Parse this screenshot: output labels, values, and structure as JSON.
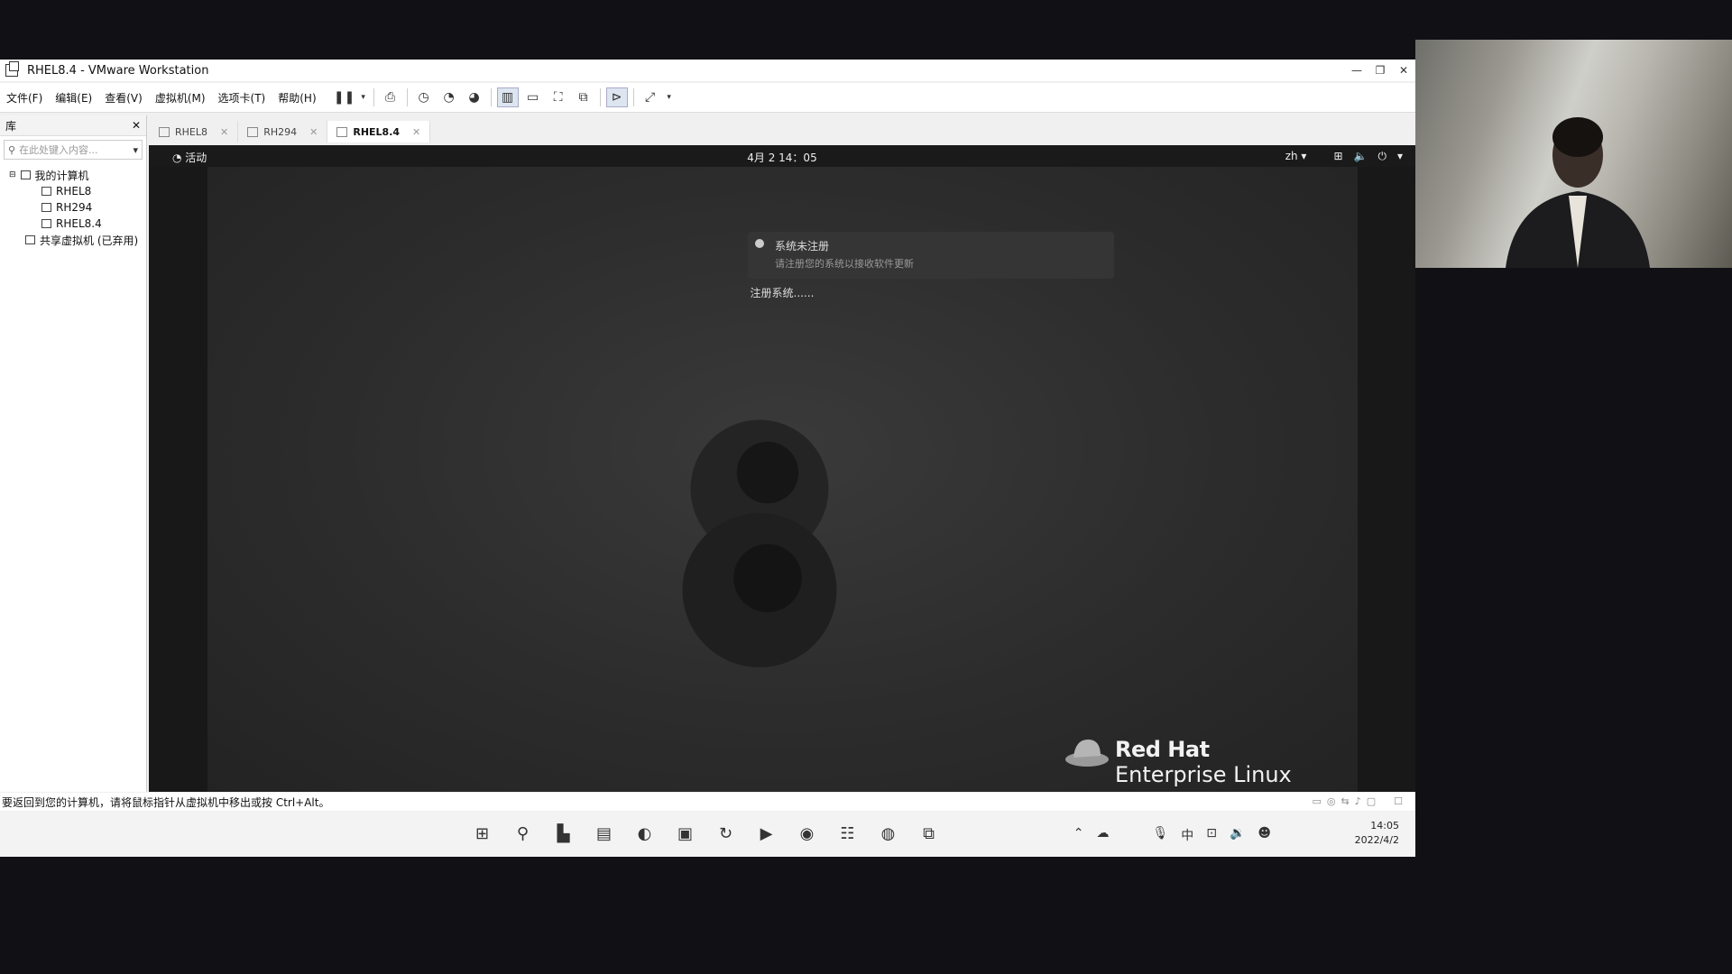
{
  "window": {
    "title": "RHEL8.4 - VMware Workstation",
    "controls": [
      "—",
      "❐",
      "✕"
    ]
  },
  "menu": [
    "文件(F)",
    "编辑(E)",
    "查看(V)",
    "虚拟机(M)",
    "选项卡(T)",
    "帮助(H)"
  ],
  "library": {
    "header": "库",
    "close": "✕",
    "search_placeholder": "在此处键入内容...",
    "tree": {
      "root": "我的计算机",
      "vms": [
        "RHEL8",
        "RH294",
        "RHEL8.4"
      ],
      "shared": "共享虚拟机 (已弃用)"
    }
  },
  "tabs": [
    {
      "label": "RHEL8",
      "active": false
    },
    {
      "label": "RH294",
      "active": false
    },
    {
      "label": "RHEL8.4",
      "active": true
    }
  ],
  "guest": {
    "activities": "活动",
    "clock": "4月 2 14：05",
    "lang": "zh ▾",
    "notification": {
      "title": "系统未注册",
      "body": "请注册您的系统以接收软件更新"
    },
    "register_button": "注册系统......",
    "brand_line1": "Red Hat",
    "brand_line2": "Enterprise Linux"
  },
  "statusbar": {
    "text": "要返回到您的计算机，请将鼠标指针从虚拟机中移出或按 Ctrl+Alt。"
  },
  "taskbar": {
    "time": "14:05",
    "date": "2022/4/2",
    "ime": "中"
  }
}
